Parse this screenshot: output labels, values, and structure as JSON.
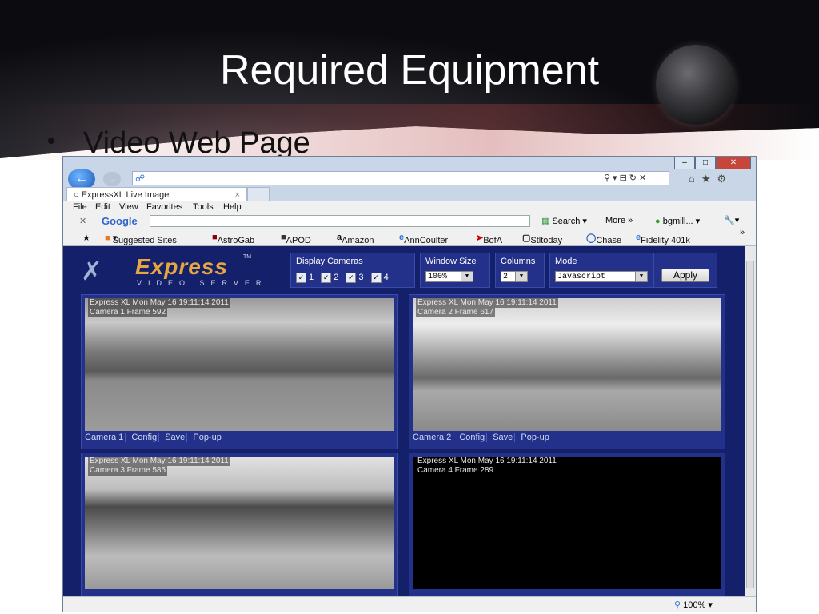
{
  "slide": {
    "title": "Required Equipment",
    "bullet": "Video Web Page"
  },
  "browser": {
    "tab_title": "ExpressXL Live Image",
    "tab_close": "×",
    "menu": [
      "File",
      "Edit",
      "View",
      "Favorites",
      "Tools",
      "Help"
    ],
    "google_label": "Google",
    "google_search": "Search",
    "google_more": "More »",
    "google_user": "bgmill...",
    "favorites": [
      "Suggested Sites",
      "AstroGab",
      "APOD",
      "Amazon",
      "AnnCoulter",
      "BofA",
      "Stltoday",
      "Chase",
      "Fidelity 401k"
    ],
    "zoom": "100%"
  },
  "app": {
    "logo_text": "Express",
    "logo_tm": "TM",
    "logo_sub": "VIDEO SERVER",
    "display_cameras_label": "Display Cameras",
    "camera_checks": [
      "1",
      "2",
      "3",
      "4"
    ],
    "window_size_label": "Window Size",
    "window_size_value": "100%",
    "columns_label": "Columns",
    "columns_value": "2",
    "mode_label": "Mode",
    "mode_value": "Javascript",
    "apply_label": "Apply"
  },
  "cameras": [
    {
      "timestamp": "Express XL Mon May 16 19:11:14 2011",
      "frame": "Camera 1 Frame 592",
      "links": [
        "Camera 1",
        "Config",
        "Save",
        "Pop-up"
      ]
    },
    {
      "timestamp": "Express XL Mon May 16 19:11:14 2011",
      "frame": "Camera 2 Frame 617",
      "links": [
        "Camera 2",
        "Config",
        "Save",
        "Pop-up"
      ]
    },
    {
      "timestamp": "Express XL Mon May 16 19:11:14 2011",
      "frame": "Camera 3 Frame 585",
      "links": []
    },
    {
      "timestamp": "Express XL Mon May 16 19:11:14 2011",
      "frame": "Camera 4 Frame 289",
      "links": []
    }
  ]
}
